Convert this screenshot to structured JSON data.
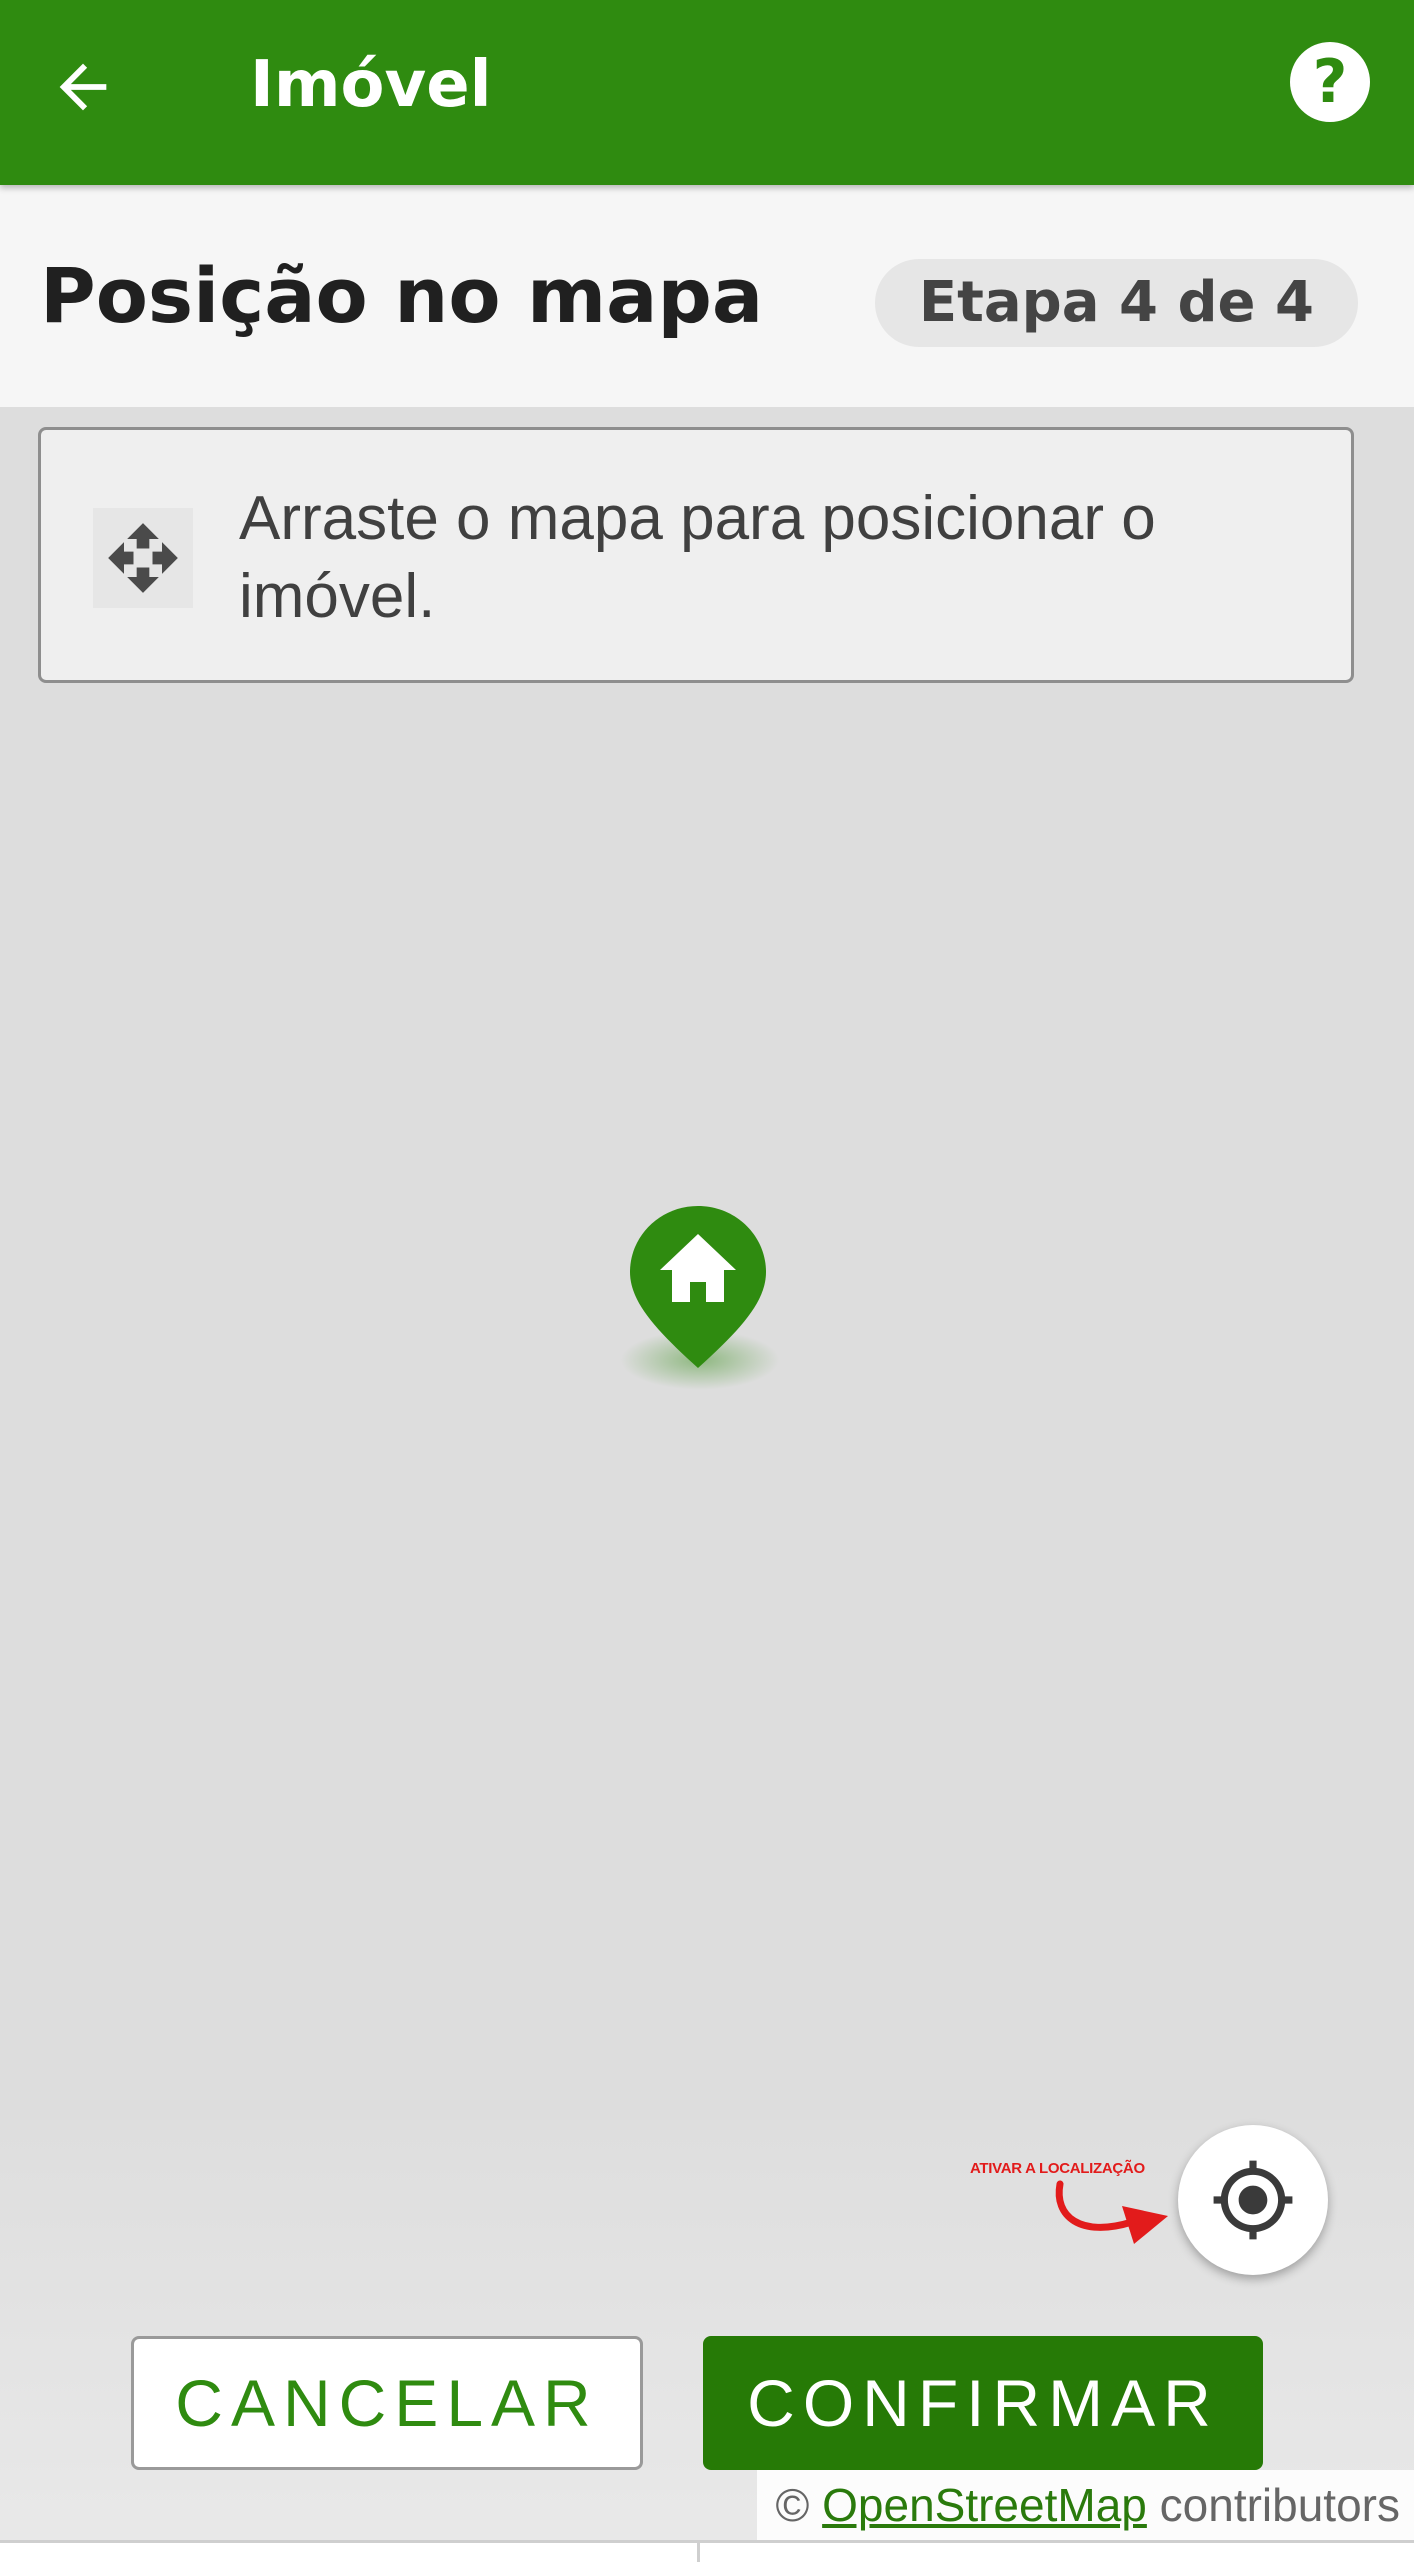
{
  "appbar": {
    "title": "Imóvel",
    "back_icon": "arrow-left-icon",
    "help_icon": "help-circle-icon",
    "help_glyph": "?",
    "background_color": "#2f8b10"
  },
  "step": {
    "title": "Posição no mapa",
    "badge": "Etapa 4 de 4"
  },
  "hint": {
    "icon": "move-arrows-icon",
    "text": "Arraste o mapa para posicionar o imóvel."
  },
  "map": {
    "marker_icon": "home-marker-icon",
    "locate_icon": "crosshair-gps-icon",
    "locate_annotation": "ATIVAR A LOCALIZAÇÃO",
    "attribution": {
      "prefix": "© ",
      "link": "OpenStreetMap",
      "suffix": " contributors"
    }
  },
  "actions": {
    "cancel_label": "CANCELAR",
    "confirm_label": "CONFIRMAR"
  },
  "colors": {
    "primary_green": "#2f8b10",
    "confirm_green": "#267a06",
    "annotation_red": "#e21b1b"
  }
}
